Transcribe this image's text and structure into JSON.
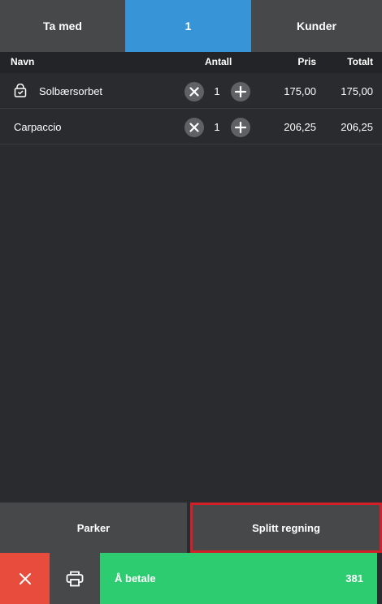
{
  "tabs": [
    {
      "label": "Ta med"
    },
    {
      "label": "1"
    },
    {
      "label": "Kunder"
    }
  ],
  "table": {
    "headers": {
      "name": "Navn",
      "qty": "Antall",
      "price": "Pris",
      "total": "Totalt"
    },
    "rows": [
      {
        "name": "Solbærsorbet",
        "qty": "1",
        "price": "175,00",
        "total": "175,00",
        "icon": "takeaway-bag-icon"
      },
      {
        "name": "Carpaccio",
        "qty": "1",
        "price": "206,25",
        "total": "206,25"
      }
    ]
  },
  "actions": {
    "park": "Parker",
    "split": "Splitt regning"
  },
  "bottom": {
    "pay_label": "Å betale",
    "pay_amount": "381"
  },
  "colors": {
    "active_tab": "#3795d7",
    "cancel": "#e74c3c",
    "pay": "#2ecc71",
    "highlight": "#d21f28"
  }
}
